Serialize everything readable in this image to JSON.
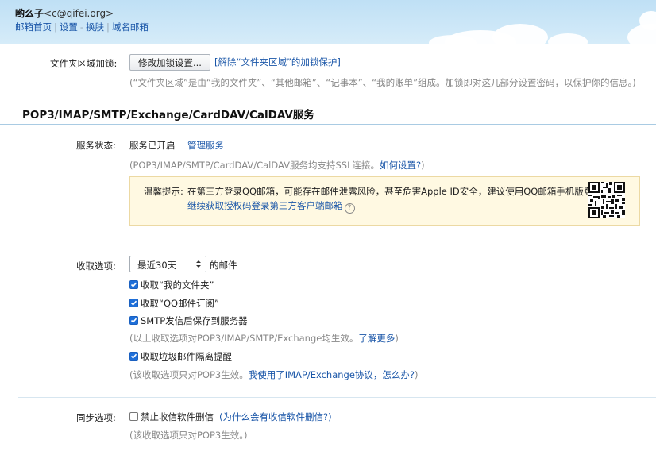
{
  "header": {
    "user_name": "哟么子",
    "user_email": "<c@qifei.org>",
    "nav": [
      "邮箱首页",
      "设置",
      "换肤",
      "域名邮箱"
    ],
    "nav_dash": "-"
  },
  "folder_lock": {
    "label": "文件夹区域加锁:",
    "button": "修改加锁设置...",
    "link": "[解除“文件夹区域”的加锁保护]",
    "hint": "(“文件夹区域”是由“我的文件夹”、“其他邮箱”、“记事本”、“我的账单”组成。加锁即对这几部分设置密码，以保护你的信息。)"
  },
  "section": {
    "title": "POP3/IMAP/SMTP/Exchange/CardDAV/CalDAV服务"
  },
  "service_status": {
    "label": "服务状态:",
    "value": "服务已开启",
    "manage_link": "管理服务",
    "hint_prefix": "(POP3/IMAP/SMTP/CardDAV/CalDAV服务均支持SSL连接。",
    "hint_link": "如何设置?",
    "hint_suffix": ")"
  },
  "warning": {
    "title": "温馨提示:",
    "text": "在第三方登录QQ邮箱，可能存在邮件泄露风险，甚至危害Apple ID安全，建议使用QQ邮箱手机版登录。",
    "link": "继续获取授权码登录第三方客户端邮箱",
    "help_icon": "?"
  },
  "receive": {
    "label": "收取选项:",
    "select_value": "最近30天",
    "select_suffix": "的邮件",
    "options": [
      {
        "label": "收取“我的文件夹”",
        "checked": true
      },
      {
        "label": "收取“QQ邮件订阅”",
        "checked": true
      },
      {
        "label": "SMTP发信后保存到服务器",
        "checked": true
      }
    ],
    "hint_prefix": "(以上收取选项对POP3/IMAP/SMTP/Exchange均生效。",
    "hint_link": "了解更多",
    "hint_suffix": ")",
    "spam_option": {
      "label": "收取垃圾邮件隔离提醒",
      "checked": true
    },
    "hint2_prefix": "(该收取选项只对POP3生效。",
    "hint2_link": "我使用了IMAP/Exchange协议，怎么办?",
    "hint2_suffix": ")"
  },
  "sync": {
    "label": "同步选项:",
    "option": {
      "label": "禁止收信软件删信",
      "checked": false
    },
    "option_link": "(为什么会有收信软件删信?)",
    "hint": "(该收取选项只对POP3生效。)"
  },
  "colors": {
    "link": "#1a56a8",
    "checkbox": "#1e6fd9",
    "warning_bg": "#fff9e2"
  }
}
